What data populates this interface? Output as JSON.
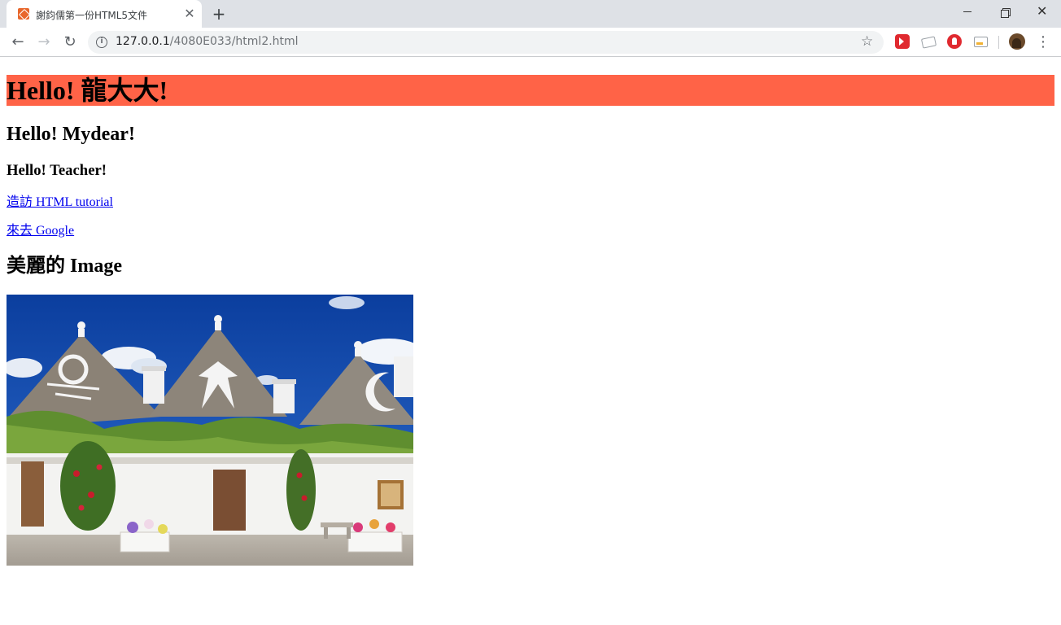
{
  "browser": {
    "tab_title": "謝鈞儒第一份HTML5文件",
    "tab_close": "✕",
    "new_tab": "+",
    "url_host": "127.0.0.1",
    "url_path": "/4080E033/html2.html",
    "icons": [
      "favicon-icon",
      "close-icon",
      "plus-icon",
      "back-icon",
      "forward-icon",
      "reload-icon",
      "info-icon",
      "star-icon",
      "extension-icon",
      "avatar",
      "menu-icon"
    ]
  },
  "page": {
    "h1": "Hello! 龍大大!",
    "h2": "Hello! Mydear!",
    "h3": "Hello! Teacher!",
    "link1": "造訪 HTML tutorial",
    "link2": "來去 Google",
    "image_heading": "美麗的 Image",
    "h1_background": "#ff6347",
    "link_color": "#0000ee"
  }
}
